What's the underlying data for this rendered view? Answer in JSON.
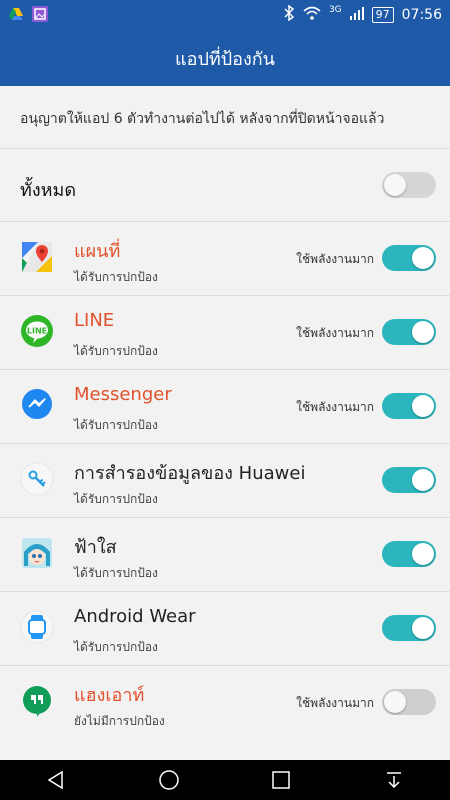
{
  "status_bar": {
    "time": "07:56",
    "battery": "97",
    "network": "3G",
    "icons": [
      "google-drive-icon",
      "gallery-icon",
      "bluetooth-icon",
      "wifi-icon",
      "signal-icon"
    ]
  },
  "app_bar": {
    "title": "แอปที่ป้องกัน"
  },
  "description": "อนุญาตให้แอป 6 ตัวทำงานต่อไปได้ หลังจากที่ปิดหน้าจอแล้ว",
  "all_toggle": {
    "label": "ทั้งหมด",
    "on": false
  },
  "apps": [
    {
      "name": "แผนที่",
      "status": "ได้รับการปกป้อง",
      "power": "ใช้พลังงานมาก",
      "on": true,
      "name_color": "#e2522b",
      "icon": "google-maps-icon"
    },
    {
      "name": "LINE",
      "status": "ได้รับการปกป้อง",
      "power": "ใช้พลังงานมาก",
      "on": true,
      "name_color": "#e2522b",
      "icon": "line-icon"
    },
    {
      "name": "Messenger",
      "status": "ได้รับการปกป้อง",
      "power": "ใช้พลังงานมาก",
      "on": true,
      "name_color": "#e2522b",
      "icon": "messenger-icon"
    },
    {
      "name": "การสำรองข้อมูลของ Huawei",
      "status": "ได้รับการปกป้อง",
      "power": "",
      "on": true,
      "name_color": "#222222",
      "icon": "huawei-backup-icon"
    },
    {
      "name": "ฟ้าใส",
      "status": "ได้รับการปกป้อง",
      "power": "",
      "on": true,
      "name_color": "#222222",
      "icon": "anime-character-icon"
    },
    {
      "name": "Android Wear",
      "status": "ได้รับการปกป้อง",
      "power": "",
      "on": true,
      "name_color": "#222222",
      "icon": "android-wear-icon"
    },
    {
      "name": "แฮงเอาท์",
      "status": "ยังไม่มีการปกป้อง",
      "power": "ใช้พลังงานมาก",
      "on": false,
      "name_color": "#e2522b",
      "icon": "hangouts-icon"
    }
  ],
  "nav": [
    "back-icon",
    "home-icon",
    "recents-icon",
    "notification-pull-icon"
  ]
}
